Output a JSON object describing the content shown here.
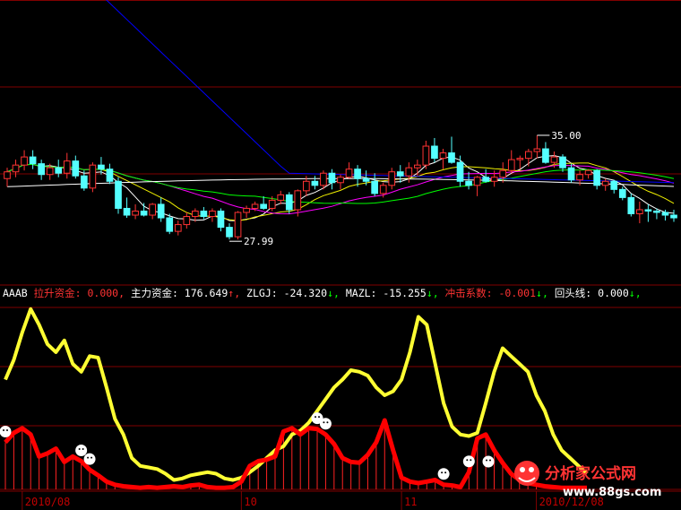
{
  "chart_data": [
    {
      "type": "candlestick",
      "panel": "price",
      "ylim": [
        24,
        45
      ],
      "price_markers": {
        "high": "35.00",
        "low": "27.99"
      },
      "colors": {
        "up": "#ff3333",
        "down": "#54ffff",
        "ma5": "#ffffff",
        "ma10": "#f0f000",
        "ma20": "#ff00ff",
        "ma30": "#00ff00",
        "ma60": "#ff00ff",
        "ma120": "#0000ff",
        "long": "#ffffff"
      },
      "candles": [
        [
          31.8,
          32.6,
          31.2,
          32.3
        ],
        [
          32.3,
          33.2,
          31.9,
          32.8
        ],
        [
          32.8,
          33.9,
          32.4,
          33.4
        ],
        [
          33.4,
          33.9,
          32.5,
          32.9
        ],
        [
          32.9,
          33.2,
          31.7,
          32.1
        ],
        [
          32.1,
          32.9,
          31.7,
          32.6
        ],
        [
          32.6,
          33.2,
          31.9,
          32.2
        ],
        [
          32.2,
          33.7,
          31.8,
          33.1
        ],
        [
          33.1,
          33.5,
          31.8,
          32.0
        ],
        [
          32.0,
          32.4,
          30.9,
          31.1
        ],
        [
          31.1,
          33.0,
          30.8,
          32.8
        ],
        [
          32.8,
          33.4,
          32.1,
          32.5
        ],
        [
          32.5,
          32.9,
          31.4,
          31.6
        ],
        [
          31.6,
          31.9,
          29.2,
          29.6
        ],
        [
          29.6,
          30.4,
          28.9,
          29.1
        ],
        [
          29.1,
          29.9,
          28.8,
          29.4
        ],
        [
          29.4,
          30.0,
          29.0,
          29.1
        ],
        [
          29.1,
          30.0,
          28.8,
          29.9
        ],
        [
          29.9,
          30.4,
          28.6,
          28.9
        ],
        [
          28.9,
          29.2,
          27.7,
          27.9
        ],
        [
          27.9,
          28.7,
          27.6,
          28.4
        ],
        [
          28.4,
          29.3,
          28.1,
          29.0
        ],
        [
          29.0,
          29.6,
          28.6,
          29.4
        ],
        [
          29.4,
          29.7,
          28.8,
          29.0
        ],
        [
          29.0,
          29.6,
          28.6,
          29.4
        ],
        [
          29.4,
          29.6,
          27.9,
          28.2
        ],
        [
          28.2,
          28.5,
          27.3,
          27.5
        ],
        [
          27.5,
          29.4,
          27.3,
          29.3
        ],
        [
          29.3,
          29.8,
          28.9,
          29.6
        ],
        [
          29.6,
          30.1,
          29.4,
          29.9
        ],
        [
          29.9,
          30.5,
          29.5,
          29.6
        ],
        [
          29.6,
          30.5,
          29.4,
          30.2
        ],
        [
          30.2,
          30.9,
          29.9,
          30.6
        ],
        [
          30.6,
          30.8,
          29.2,
          29.5
        ],
        [
          29.5,
          31.0,
          29.0,
          30.9
        ],
        [
          30.9,
          32.0,
          30.5,
          31.6
        ],
        [
          31.6,
          32.0,
          31.0,
          31.3
        ],
        [
          31.3,
          32.4,
          31.0,
          32.2
        ],
        [
          32.2,
          32.5,
          31.0,
          31.5
        ],
        [
          31.5,
          32.1,
          31.0,
          31.9
        ],
        [
          31.9,
          33.0,
          31.8,
          32.5
        ],
        [
          32.5,
          32.8,
          31.2,
          31.8
        ],
        [
          31.8,
          32.4,
          31.3,
          31.6
        ],
        [
          31.6,
          32.2,
          30.5,
          30.7
        ],
        [
          30.7,
          31.5,
          30.4,
          31.3
        ],
        [
          31.3,
          32.6,
          31.0,
          32.3
        ],
        [
          32.3,
          32.8,
          31.5,
          32.0
        ],
        [
          32.0,
          33.0,
          31.5,
          32.6
        ],
        [
          32.6,
          33.2,
          32.0,
          32.8
        ],
        [
          32.8,
          34.6,
          32.5,
          34.2
        ],
        [
          34.2,
          34.8,
          33.0,
          33.3
        ],
        [
          33.3,
          34.0,
          32.5,
          33.7
        ],
        [
          33.7,
          34.9,
          32.9,
          33.0
        ],
        [
          33.0,
          33.5,
          31.2,
          31.6
        ],
        [
          31.6,
          32.3,
          31.0,
          31.3
        ],
        [
          31.3,
          32.0,
          30.5,
          31.9
        ],
        [
          31.9,
          32.5,
          31.5,
          31.6
        ],
        [
          31.6,
          32.4,
          31.2,
          31.9
        ],
        [
          31.9,
          33.0,
          31.5,
          32.4
        ],
        [
          32.4,
          33.9,
          32.2,
          33.2
        ],
        [
          33.2,
          33.5,
          32.5,
          33.3
        ],
        [
          33.3,
          34.0,
          32.7,
          33.8
        ],
        [
          33.8,
          35.0,
          33.3,
          34.0
        ],
        [
          34.0,
          34.5,
          32.9,
          33.0
        ],
        [
          33.0,
          33.8,
          32.6,
          33.4
        ],
        [
          33.4,
          33.6,
          32.3,
          32.6
        ],
        [
          32.6,
          32.9,
          31.5,
          31.7
        ],
        [
          31.7,
          32.4,
          31.3,
          32.1
        ],
        [
          32.1,
          32.5,
          31.8,
          32.4
        ],
        [
          32.4,
          32.5,
          31.0,
          31.3
        ],
        [
          31.3,
          31.8,
          30.9,
          31.6
        ],
        [
          31.6,
          31.7,
          30.7,
          31.0
        ],
        [
          31.0,
          31.2,
          30.2,
          30.4
        ],
        [
          30.4,
          30.7,
          29.0,
          29.2
        ],
        [
          29.2,
          30.1,
          28.5,
          29.5
        ],
        [
          29.5,
          29.9,
          28.6,
          29.4
        ],
        [
          29.4,
          29.6,
          28.8,
          29.3
        ],
        [
          29.3,
          29.5,
          28.7,
          29.1
        ],
        [
          29.1,
          29.5,
          28.6,
          28.9
        ]
      ]
    },
    {
      "type": "line",
      "panel": "indicator",
      "indicator_bar": {
        "code": "AAAB",
        "items": [
          {
            "label": "拉升资金",
            "value": "0.000,",
            "color": "#ff3333"
          },
          {
            "label": "主力资金",
            "value": "176.649",
            "arrow": "↑",
            "color": "#ffffff"
          },
          {
            "label": "ZLGJ",
            "value": "-24.320",
            "arrow": "↓",
            "color": "#ffffff"
          },
          {
            "label": "MAZL",
            "value": "-15.255",
            "arrow": "↓",
            "color": "#ffffff"
          },
          {
            "label": "冲击系数",
            "value": "-0.001",
            "arrow": "↓",
            "color": "#ff3333"
          },
          {
            "label": "回头线",
            "value": "0.000",
            "arrow": "↓",
            "color": "#ffffff"
          }
        ]
      },
      "x_ticks": [
        {
          "label": "2010/08",
          "index": 2
        },
        {
          "label": "10",
          "index": 33
        },
        {
          "label": "11",
          "index": 55
        },
        {
          "label": "2010/12/08",
          "index": 73
        }
      ],
      "series": [
        {
          "color": "#ffff33",
          "values": [
            140,
            165,
            200,
            230,
            210,
            185,
            175,
            190,
            160,
            150,
            170,
            168,
            130,
            90,
            70,
            40,
            30,
            28,
            26,
            20,
            12,
            14,
            18,
            20,
            22,
            20,
            14,
            12,
            15,
            22,
            30,
            40,
            50,
            55,
            70,
            75,
            85,
            100,
            115,
            130,
            140,
            152,
            150,
            145,
            130,
            120,
            125,
            140,
            175,
            220,
            210,
            160,
            110,
            80,
            70,
            68,
            72,
            110,
            150,
            180,
            170,
            160,
            150,
            120,
            100,
            70,
            50,
            40,
            30,
            20
          ]
        },
        {
          "color": "#ff0000",
          "values": [
            60,
            72,
            78,
            70,
            42,
            46,
            52,
            35,
            42,
            36,
            25,
            18,
            10,
            6,
            4,
            3,
            2,
            3,
            2,
            3,
            4,
            3,
            5,
            6,
            3,
            2,
            2,
            3,
            10,
            30,
            36,
            38,
            42,
            74,
            78,
            70,
            78,
            77,
            70,
            58,
            40,
            35,
            34,
            44,
            60,
            88,
            50,
            15,
            10,
            8,
            10,
            12,
            6,
            5,
            3,
            22,
            65,
            70,
            50,
            34,
            20,
            12,
            8,
            6,
            4,
            3,
            2,
            2,
            2,
            2
          ]
        }
      ],
      "ylim": [
        0,
        240
      ]
    }
  ],
  "watermark": {
    "title": "分析家公式网",
    "url": "www.88gs.com"
  }
}
